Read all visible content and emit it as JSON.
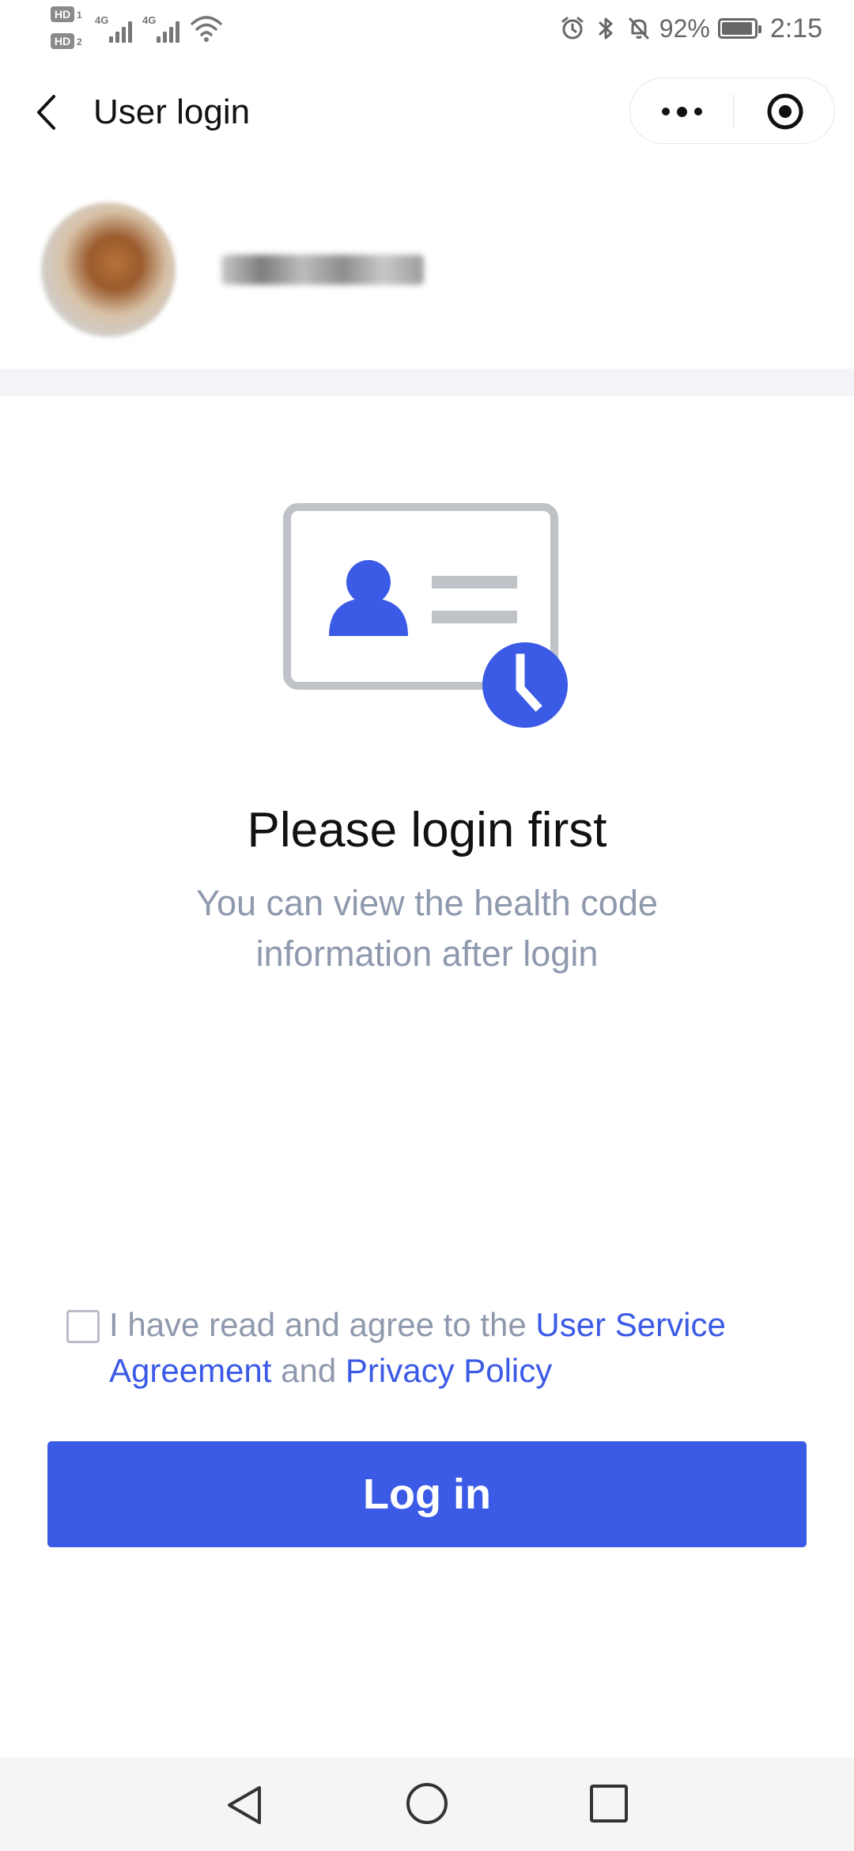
{
  "status_bar": {
    "hd1": "HD",
    "hd1_sub": "1",
    "hd2": "HD",
    "hd2_sub": "2",
    "signal1_tag": "4G",
    "signal2_tag": "4G",
    "battery_percent": "92%",
    "time": "2:15",
    "icons": [
      "alarm-icon",
      "bluetooth-icon",
      "bell-off-icon"
    ]
  },
  "header": {
    "title": "User login"
  },
  "illustration": {
    "icon": "id-card-clock-icon",
    "accent_color": "#3b5ae6",
    "frame_color": "#bfc3c8"
  },
  "main": {
    "headline": "Please login first",
    "subtext": "You can view the health code information after login"
  },
  "agreement": {
    "checked": false,
    "prefix": "I have read and agree to the ",
    "link1": "User Service Agreement",
    "middle": " and ",
    "link2": "Privacy Policy"
  },
  "login_button": {
    "label": "Log in",
    "color": "#3b5ae6"
  }
}
